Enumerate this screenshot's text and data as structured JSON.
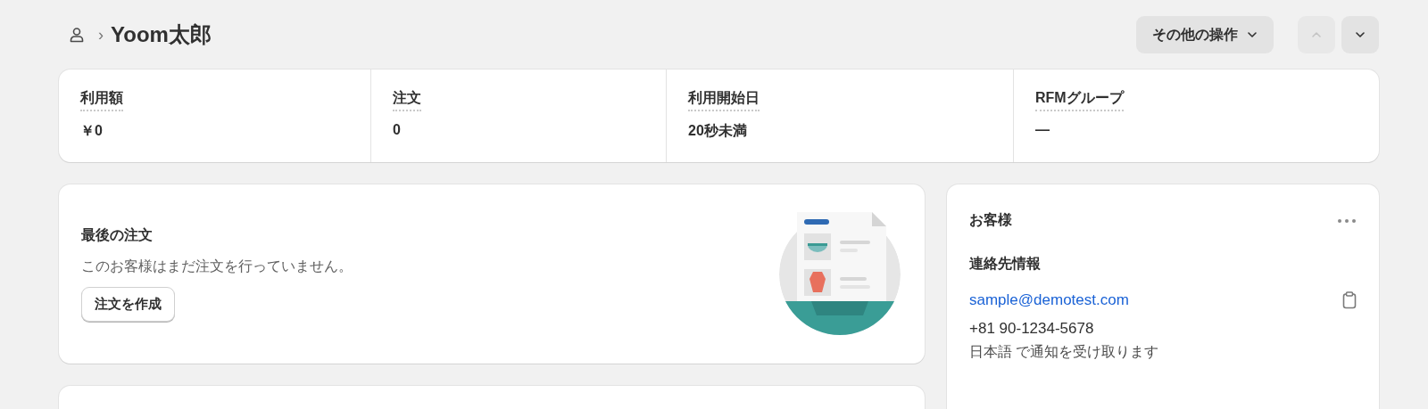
{
  "header": {
    "breadcrumb_separator": "›",
    "title": "Yoom太郎",
    "more_actions": "その他の操作",
    "prev_button": {
      "disabled": true
    },
    "next_button": {
      "disabled": false
    }
  },
  "stats": [
    {
      "label": "利用額",
      "value": "￥0"
    },
    {
      "label": "注文",
      "value": "0"
    },
    {
      "label": "利用開始日",
      "value": "20秒未満"
    },
    {
      "label": "RFMグループ",
      "value": "—"
    }
  ],
  "last_order": {
    "title": "最後の注文",
    "message": "このお客様はまだ注文を行っていません。",
    "button": "注文を作成"
  },
  "customer": {
    "title": "お客様",
    "contact_heading": "連絡先情報",
    "email": "sample@demotest.com",
    "phone": "+81 90-1234-5678",
    "notification": "日本語 で通知を受け取ります"
  }
}
